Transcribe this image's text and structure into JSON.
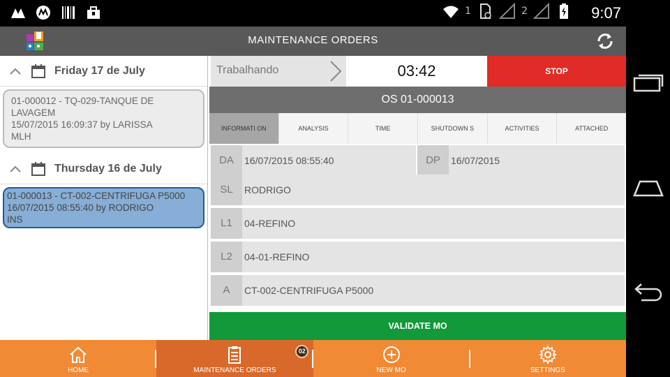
{
  "statusbar": {
    "clock": "9:07",
    "sim1": "1",
    "sim2": "2",
    "icons": [
      "notification-icon",
      "motorola-icon",
      "barcode-icon",
      "bag-icon",
      "wifi-icon",
      "signal-icon",
      "battery-icon"
    ]
  },
  "app": {
    "title": "MAINTENANCE ORDERS",
    "left_pane": {
      "groups": [
        {
          "date": "Friday 17 de July",
          "orders": [
            {
              "lines": [
                "01-000012 - TQ-029-TANQUE DE LAVAGEM",
                "15/07/2015 16:09:37 by LARISSA",
                "MLH"
              ]
            }
          ]
        },
        {
          "date": "Thursday 16 de July",
          "orders": [
            {
              "lines": [
                "01-000013 - CT-002-CENTRIFUGA P5000",
                "16/07/2015 08:55:40 by RODRIGO",
                "INS"
              ]
            }
          ]
        }
      ]
    },
    "detail": {
      "status": "Trabalhando",
      "timer": "03:42",
      "stop_label": "STOP",
      "os_title": "OS 01-000013",
      "tabs": [
        "INFORMATION",
        "ANALYSIS",
        "TIME",
        "SHUTDOWNS",
        "ACTIVITIES",
        "ATTACHED"
      ],
      "tabs_display": [
        "INFORMATI ON",
        "ANALYSIS",
        "TIME",
        "SHUTDOWN S",
        "ACTIVITIES",
        "ATTACHED"
      ],
      "fields": {
        "da_key": "DA",
        "da_val": "16/07/2015 08:55:40",
        "dp_key": "DP",
        "dp_val": "16/07/2015",
        "sl_key": "SL",
        "sl_val": "RODRIGO",
        "l1_key": "L1",
        "l1_val": "04-REFINO",
        "l2_key": "L2",
        "l2_val": "04-01-REFINO",
        "a_key": "A",
        "a_val": "CT-002-CENTRIFUGA P5000"
      },
      "validate_label": "VALIDATE MO"
    },
    "bottom_nav": {
      "home": "HOME",
      "orders": "MAINTENANCE ORDERS",
      "orders_badge": "02",
      "new_mo": "NEW MO",
      "settings": "SETTINGS"
    }
  },
  "colors": {
    "titlebar": "#595959",
    "stop": "#e02b27",
    "validate": "#11993a",
    "nav": "#f18a34",
    "nav_active": "#d9692a",
    "selected_card": "#86aed6"
  }
}
